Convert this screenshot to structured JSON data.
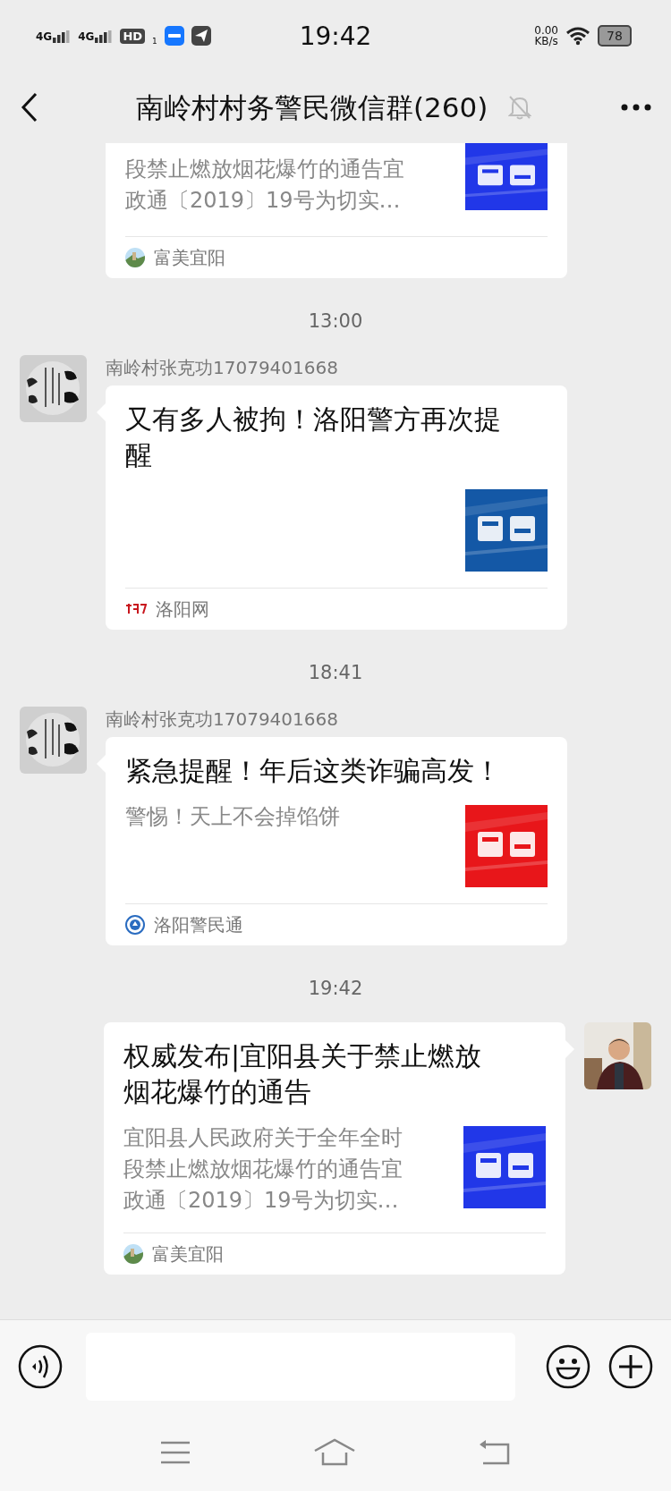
{
  "status_bar": {
    "network_types": [
      "4G",
      "4G"
    ],
    "hd_label": "HD",
    "hd_sub": "1",
    "time": "19:42",
    "speed": "0.00",
    "speed_unit": "KB/s",
    "battery": "78"
  },
  "header": {
    "title": "南岭村村务警民微信群(260)",
    "muted": true
  },
  "chat": [
    {
      "kind": "article",
      "outgoing": false,
      "clipped": true,
      "description": "段禁止燃放烟花爆竹的通告宜政通〔2019〕19号为切实…",
      "source": {
        "name": "富美宜阳"
      }
    },
    {
      "kind": "time",
      "text": "13:00"
    },
    {
      "kind": "article",
      "outgoing": false,
      "clipped": false,
      "avatar": {
        "kind": "calligraphy"
      },
      "sender": "南岭村张克功17079401668",
      "title": "又有多人被拘！洛阳警方再次提醒",
      "source": {
        "kind": "logo",
        "name": "洛阳网"
      }
    },
    {
      "kind": "time",
      "text": "18:41"
    },
    {
      "kind": "article",
      "outgoing": false,
      "clipped": false,
      "avatar": {
        "kind": "calligraphy"
      },
      "sender": "南岭村张克功17079401668",
      "title": "紧急提醒！年后这类诈骗高发！",
      "description": "警惕！天上不会掉馅饼",
      "source": {
        "kind": "emblem",
        "name": "洛阳警民通"
      }
    },
    {
      "kind": "time",
      "text": "19:42"
    },
    {
      "kind": "article",
      "outgoing": true,
      "clipped": false,
      "avatar": {
        "kind": "portrait"
      },
      "title": "权威发布|宜阳县关于禁止燃放烟花爆竹的通告",
      "description": "宜阳县人民政府关于全年全时段禁止燃放烟花爆竹的通告宜政通〔2019〕19号为切实…",
      "source": {
        "name": "富美宜阳"
      }
    }
  ]
}
